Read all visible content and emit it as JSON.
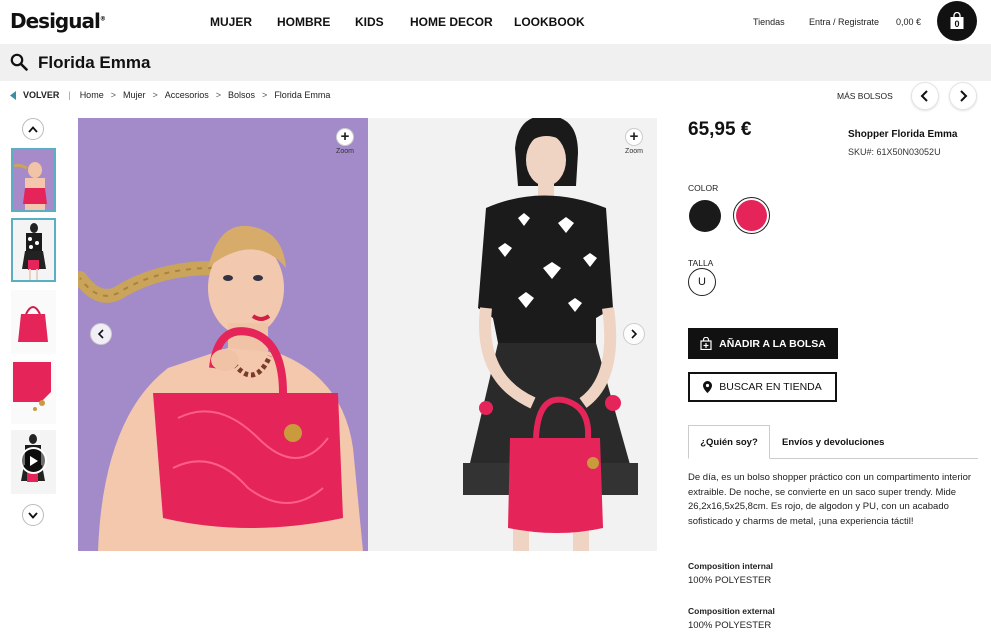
{
  "header": {
    "logo": "Desigual",
    "nav": [
      "MUJER",
      "HOMBRE",
      "KIDS",
      "HOME DECOR",
      "LOOKBOOK"
    ],
    "stores_link": "Tiendas",
    "login_link": "Entra / Registrate",
    "cart_total": "0,00 €",
    "cart_count": "0"
  },
  "search": {
    "query": "Florida Emma"
  },
  "breadcrumb": {
    "back": "VOLVER",
    "items": [
      "Home",
      "Mujer",
      "Accesorios",
      "Bolsos",
      "Florida Emma"
    ],
    "more_label": "MÁS BOLSOS"
  },
  "gallery": {
    "zoom_label": "Zoom"
  },
  "product": {
    "price": "65,95 €",
    "name": "Shopper Florida Emma",
    "sku": "SKU#: 61X50N03052U",
    "color_label": "COLOR",
    "colors": [
      "#1a1a1a",
      "#e5245a"
    ],
    "size_label": "TALLA",
    "size": "U",
    "add_button": "AÑADIR A LA BOLSA",
    "store_button": "BUSCAR EN TIENDA",
    "tabs": [
      "¿Quién soy?",
      "Envíos y devoluciones"
    ],
    "description": "De día, es un bolso shopper práctico con un compartimento interior extraible. De noche, se convierte en un saco super trendy. Mide 26,2x16,5x25,8cm. Es rojo, de algodon y PU, con un acabado sofisticado y charms de metal, ¡una experiencia táctil!",
    "composition_internal_label": "Composition internal",
    "composition_internal": "100% POLYESTER",
    "composition_external_label": "Composition external",
    "composition_external": "100% POLYESTER"
  },
  "colors": {
    "accent": "#111111",
    "bag_red": "#e5245a",
    "thumb_border": "#5ab0c2",
    "searchbar_bg": "#f0f0f0"
  }
}
